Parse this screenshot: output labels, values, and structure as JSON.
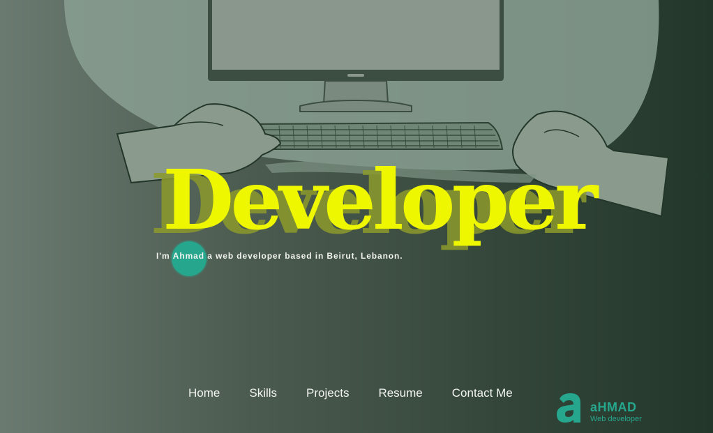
{
  "hero": {
    "title": "Developer",
    "tagline_prefix": "I'm",
    "tagline_name": "Ahmad",
    "tagline_suffix": "a web developer based in Beirut, Lebanon."
  },
  "nav": {
    "items": [
      {
        "label": "Home"
      },
      {
        "label": "Skills"
      },
      {
        "label": "Projects"
      },
      {
        "label": "Resume"
      },
      {
        "label": "Contact Me"
      }
    ]
  },
  "logo": {
    "letter": "a",
    "name": "aHMAD",
    "subtitle": "Web developer"
  },
  "colors": {
    "accent": "#27a68e",
    "title": "#eef700",
    "title_shadow": "#8c9a2c"
  },
  "icons": [
    "desk-illustration-icon",
    "logo-a-icon"
  ]
}
